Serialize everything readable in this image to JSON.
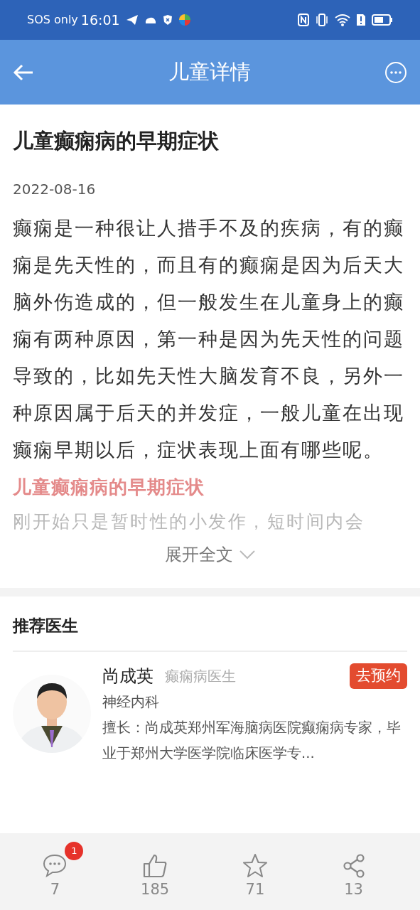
{
  "status_bar": {
    "carrier": "SOS only",
    "time": "16:01"
  },
  "header": {
    "title": "儿童详情"
  },
  "article": {
    "title": "儿童癫痫病的早期症状",
    "date": "2022-08-16",
    "body": "癫痫是一种很让人措手不及的疾病，有的癫痫是先天性的，而且有的癫痫是因为后天大脑外伤造成的，但一般发生在儿童身上的癫痫有两种原因，第一种是因为先天性的问题导致的，比如先天性大脑发育不良，另外一种原因属于后天的并发症，一般儿童在出现癫痫早期以后，症状表现上面有哪些呢。",
    "subheading": "儿童癫痫病的早期症状",
    "faded_line": "刚开始只是暂时性的小发作，短时间内会",
    "expand_label": "展开全文",
    "expanded": false
  },
  "doctors_section": {
    "title": "推荐医生",
    "doctors": [
      {
        "name": "尚成英",
        "title": "癫痫病医生",
        "department": "神经内科",
        "expertise": "擅长：尚成英郑州军海脑病医院癫痫病专家，毕业于郑州大学医学院临床医学专...",
        "action": "去预约"
      }
    ]
  },
  "bottom_bar": [
    {
      "kind": "comment",
      "count": "7",
      "badge": "1"
    },
    {
      "kind": "like",
      "count": "185"
    },
    {
      "kind": "star",
      "count": "71"
    },
    {
      "kind": "share",
      "count": "13"
    }
  ]
}
